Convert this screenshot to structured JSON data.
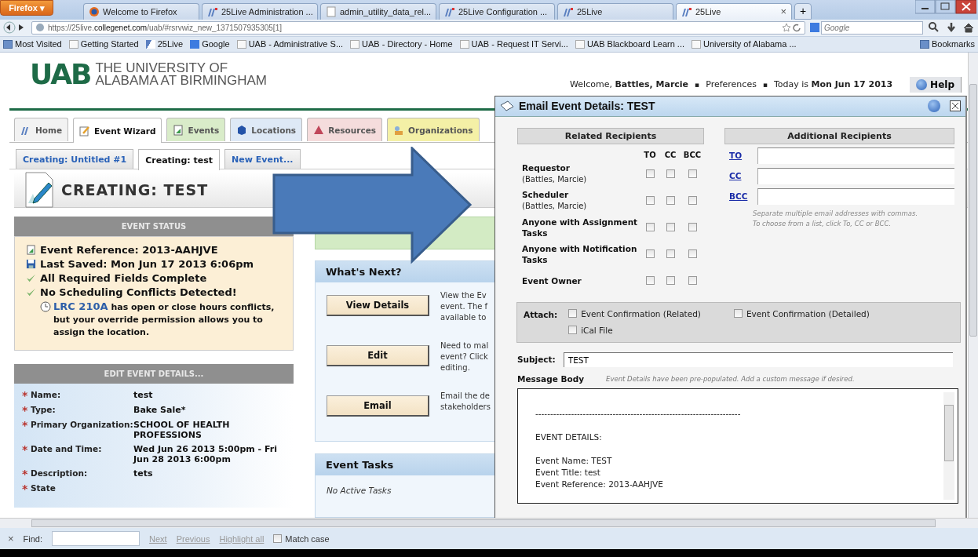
{
  "browser": {
    "menu_button": "Firefox ▾",
    "tabs": [
      {
        "title": "Welcome to Firefox",
        "selected": false,
        "kind": "firefox"
      },
      {
        "title": "25Live Administration ...",
        "selected": false,
        "kind": "live"
      },
      {
        "title": "admin_utility_data_rel...",
        "selected": false,
        "kind": "blank"
      },
      {
        "title": "25Live Configuration ...",
        "selected": false,
        "kind": "live"
      },
      {
        "title": "25Live",
        "selected": false,
        "kind": "live"
      },
      {
        "title": "25Live",
        "selected": true,
        "kind": "live"
      }
    ],
    "tab_close": "×",
    "new_tab": "+",
    "url": "https://25live.**collegenet.com**/uab/#rsrvwiz_new_1371507935305[1]",
    "search_placeholder": "Google",
    "bookmarks": [
      {
        "label": "Most Visited",
        "kind": "special"
      },
      {
        "label": "Getting Started",
        "kind": "page"
      },
      {
        "label": "25Live",
        "kind": "live"
      },
      {
        "label": "Google",
        "kind": "google"
      },
      {
        "label": "UAB - Administrative S...",
        "kind": "page"
      },
      {
        "label": "UAB - Directory - Home",
        "kind": "page"
      },
      {
        "label": "UAB - Request IT Servi...",
        "kind": "page"
      },
      {
        "label": "UAB Blackboard Learn ...",
        "kind": "page"
      },
      {
        "label": "University of Alabama ...",
        "kind": "page"
      }
    ],
    "bookmarks_menu": "Bookmarks"
  },
  "page": {
    "logo": {
      "mark": "UAB",
      "line1": "THE UNIVERSITY OF",
      "line2": "ALABAMA AT BIRMINGHAM"
    },
    "welcome": "Welcome, **Battles, Marcie**",
    "separator": "▪",
    "preferences": "Preferences",
    "today": "Today is **Mon Jun 17 2013**",
    "help": "Help",
    "nav_tabs": [
      {
        "label": "Home",
        "selected": false,
        "kind": "home",
        "color": "#f2f2f2"
      },
      {
        "label": "Event Wizard",
        "selected": true,
        "kind": "wizard",
        "color": "#ffffff"
      },
      {
        "label": "Events",
        "selected": false,
        "kind": "events",
        "color": "#d9ecc9"
      },
      {
        "label": "Locations",
        "selected": false,
        "kind": "locations",
        "color": "#dee9f6"
      },
      {
        "label": "Resources",
        "selected": false,
        "kind": "resources",
        "color": "#f5dcdc"
      },
      {
        "label": "Organizations",
        "selected": false,
        "kind": "organizations",
        "color": "#f4f0a6"
      }
    ],
    "sub_tabs": [
      {
        "label": "Creating: Untitled #1",
        "selected": false
      },
      {
        "label": "Creating: test",
        "selected": true
      },
      {
        "label": "New Event...",
        "selected": false
      }
    ],
    "title": "CREATING: TEST",
    "event_status": {
      "header": "EVENT STATUS",
      "items": [
        {
          "kind": "reference",
          "text": "Event Reference: 2013-AAHJVE"
        },
        {
          "kind": "saved",
          "text": "Last Saved: Mon Jun 17 2013 6:06pm"
        },
        {
          "kind": "check",
          "text": "All Required Fields Complete"
        },
        {
          "kind": "check",
          "text": "No Scheduling Conflicts Detected!"
        }
      ],
      "note": {
        "link": "LRC 210A",
        "text": "has open or close hours conflicts, but your override permission allows you to assign the location."
      }
    },
    "edit_details": {
      "header": "EDIT EVENT DETAILS...",
      "required_mark": "*",
      "fields": [
        {
          "label": "Name:",
          "value": "test",
          "required": true
        },
        {
          "label": "Type:",
          "value": "Bake Sale*",
          "required": true
        },
        {
          "label": "Primary Organization:",
          "value": "SCHOOL OF HEALTH PROFESSIONS",
          "required": true
        },
        {
          "label": "Date and Time:",
          "value": "Wed Jun 26 2013 5:00pm - Fri Jun 28 2013 6:00pm",
          "required": true
        },
        {
          "label": "Description:",
          "value": "tets",
          "required": true
        },
        {
          "label": "State",
          "required": true
        }
      ]
    },
    "whats_next": {
      "title": "What's Next?",
      "actions": [
        {
          "button": "View Details",
          "lines": [
            "View the Ev",
            "event. The f",
            "available to"
          ]
        },
        {
          "button": "Edit",
          "lines": [
            "Need to mal",
            "event? Click",
            "editing."
          ]
        },
        {
          "button": "Email",
          "lines": [
            "Email the de",
            "stakeholders"
          ]
        }
      ]
    },
    "event_tasks": {
      "title": "Event Tasks",
      "empty": "No Active Tasks"
    }
  },
  "dialog": {
    "title": "Email Event Details: TEST",
    "related": {
      "header": "Related Recipients",
      "columns": [
        "TO",
        "CC",
        "BCC"
      ],
      "rows": [
        {
          "label": "Requestor",
          "sublabel": "(Battles, Marcie)",
          "checks": [
            false,
            false,
            false
          ]
        },
        {
          "label": "Scheduler",
          "sublabel": "(Battles, Marcie)",
          "checks": [
            false,
            false,
            false
          ]
        },
        {
          "label": "Anyone with Assignment Tasks",
          "checks": [
            false,
            false,
            false
          ]
        },
        {
          "label": "Anyone with Notification Tasks",
          "checks": [
            false,
            false,
            false
          ]
        },
        {
          "label": "Event Owner",
          "checks": [
            false,
            false,
            false
          ]
        }
      ]
    },
    "additional": {
      "header": "Additional Recipients",
      "fields": [
        {
          "label": "TO"
        },
        {
          "label": "CC"
        },
        {
          "label": "BCC"
        }
      ],
      "hint": [
        "Separate multiple email addresses with commas.",
        "To choose from a list, click To, CC or BCC."
      ]
    },
    "attach": {
      "label": "Attach:",
      "options": [
        {
          "label": "Event Confirmation (Related)",
          "checked": false
        },
        {
          "label": "Event Confirmation (Detailed)",
          "checked": false
        },
        {
          "label": "iCal File",
          "checked": false
        }
      ]
    },
    "subject": {
      "label": "Subject:",
      "value": "TEST"
    },
    "message": {
      "label": "Message Body",
      "hint": "Event Details have been pre-populated. Add a custom message if desired.",
      "paragraphs": [
        [
          "---------------------------------------------------------------------"
        ],
        [
          "EVENT DETAILS:"
        ],
        [
          "Event Name: TEST",
          "Event Title: test",
          "Event Reference: 2013-AAHJVE"
        ]
      ]
    }
  },
  "find_bar": {
    "close": "×",
    "label": "Find:",
    "next": "Next",
    "previous": "Previous",
    "highlight": "Highlight all",
    "match_case": {
      "label": "Match case",
      "checked": false
    }
  }
}
